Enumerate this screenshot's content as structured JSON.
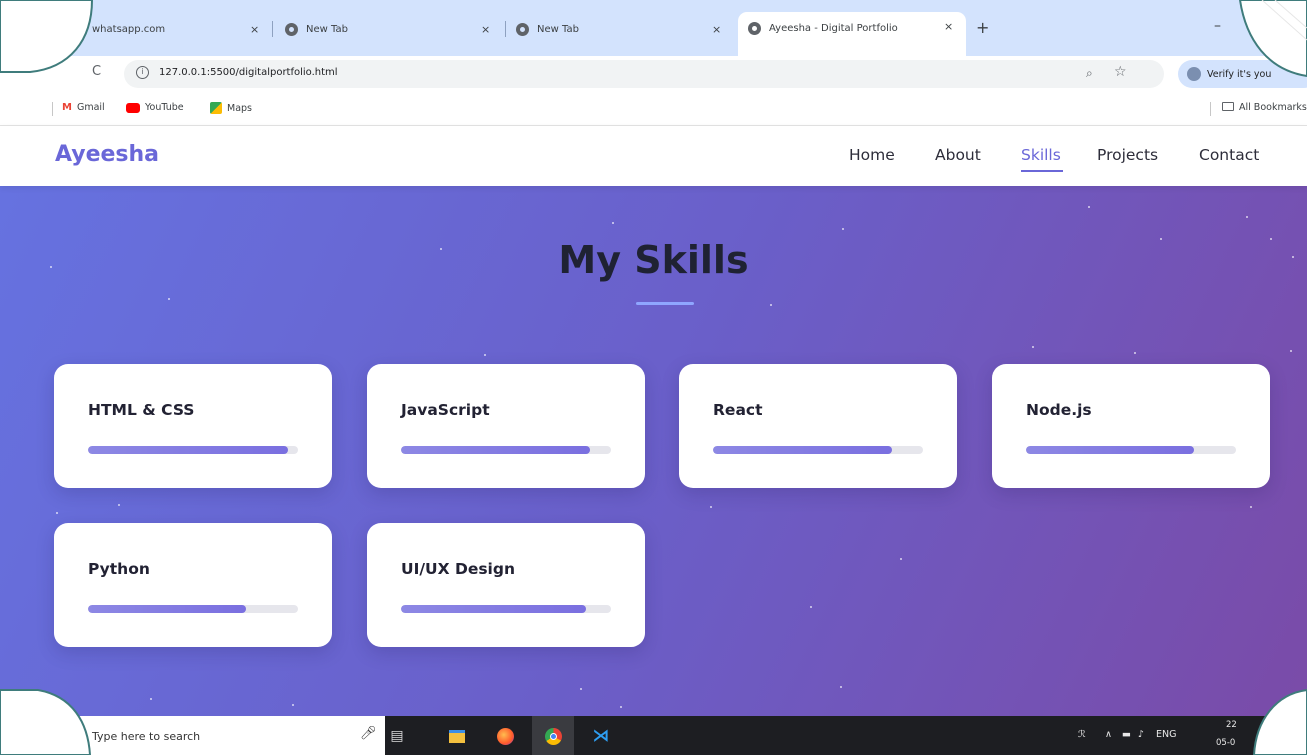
{
  "browser": {
    "tabs": [
      {
        "title": "whatsapp.com",
        "active": false
      },
      {
        "title": "New Tab",
        "active": false
      },
      {
        "title": "New Tab",
        "active": false
      },
      {
        "title": "Ayeesha - Digital Portfolio",
        "active": true
      }
    ],
    "close_glyph": "×",
    "new_tab_glyph": "+",
    "minimize_glyph": "–",
    "reload_glyph": "C",
    "url": "127.0.0.1:5500/digitalportfolio.html",
    "verify_chip": "Verify it's you",
    "bookmarks": [
      {
        "label": "Gmail",
        "icon": "gmail-icon",
        "color": "#ea4335"
      },
      {
        "label": "YouTube",
        "icon": "youtube-icon",
        "color": "#ff0000"
      },
      {
        "label": "Maps",
        "icon": "maps-icon",
        "color": "#34a853"
      }
    ],
    "all_bookmarks": "All Bookmarks"
  },
  "site": {
    "logo": "Ayeesha",
    "nav": [
      {
        "label": "Home",
        "active": false
      },
      {
        "label": "About",
        "active": false
      },
      {
        "label": "Skills",
        "active": true
      },
      {
        "label": "Projects",
        "active": false
      },
      {
        "label": "Contact",
        "active": false
      }
    ],
    "accent_color": "#6a67d8",
    "section_title": "My Skills",
    "skills": [
      {
        "name": "HTML & CSS",
        "level": 0.95
      },
      {
        "name": "JavaScript",
        "level": 0.9
      },
      {
        "name": "React",
        "level": 0.85
      },
      {
        "name": "Node.js",
        "level": 0.8
      },
      {
        "name": "Python",
        "level": 0.75
      },
      {
        "name": "UI/UX Design",
        "level": 0.88
      }
    ]
  },
  "taskbar": {
    "search_placeholder": "Type here to search",
    "apps": [
      "task-view-icon",
      "file-explorer-icon",
      "firefox-icon",
      "chrome-icon",
      "vscode-icon"
    ],
    "language": "ENG",
    "time": "22",
    "date": "05-0"
  }
}
